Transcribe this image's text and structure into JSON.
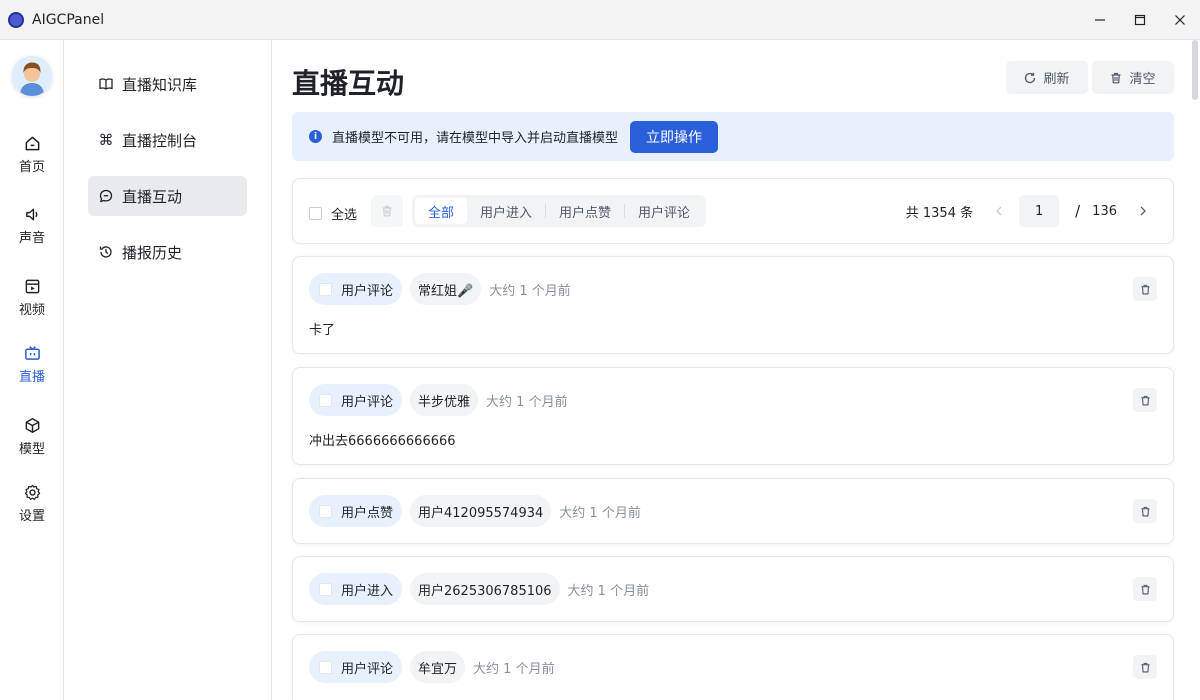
{
  "window": {
    "title": "AIGCPanel"
  },
  "leftnav": [
    {
      "label": "首页",
      "icon": "home-icon"
    },
    {
      "label": "声音",
      "icon": "speaker-icon"
    },
    {
      "label": "视频",
      "icon": "film-icon"
    },
    {
      "label": "直播",
      "icon": "tv-icon",
      "active": true
    },
    {
      "label": "模型",
      "icon": "cube-icon"
    },
    {
      "label": "设置",
      "icon": "gear-icon"
    }
  ],
  "subnav": [
    {
      "label": "直播知识库",
      "icon": "book-icon"
    },
    {
      "label": "直播控制台",
      "icon": "command-icon"
    },
    {
      "label": "直播互动",
      "icon": "chat-icon",
      "active": true
    },
    {
      "label": "播报历史",
      "icon": "history-icon"
    }
  ],
  "main": {
    "title": "直播互动",
    "refresh_label": "刷新",
    "clear_label": "清空",
    "alert": {
      "text": "直播模型不可用，请在模型中导入并启动直播模型",
      "button": "立即操作"
    },
    "toolbar": {
      "select_all": "全选",
      "filters": [
        "全部",
        "用户进入",
        "用户点赞",
        "用户评论"
      ],
      "active_filter": "全部",
      "total": "共 1354 条",
      "current_page": "1",
      "slash": "/",
      "total_pages": "136"
    },
    "items": [
      {
        "type": "用户评论",
        "user": "常红姐🎤",
        "time": "大约 1 个月前",
        "content": "卡了"
      },
      {
        "type": "用户评论",
        "user": "半步优雅",
        "time": "大约 1 个月前",
        "content": "冲出去6666666666666"
      },
      {
        "type": "用户点赞",
        "user": "用户412095574934",
        "time": "大约 1 个月前",
        "content": ""
      },
      {
        "type": "用户进入",
        "user": "用户2625306785106",
        "time": "大约 1 个月前",
        "content": ""
      },
      {
        "type": "用户评论",
        "user": "牟宜万",
        "time": "大约 1 个月前",
        "content": ""
      }
    ]
  },
  "colors": {
    "accent": "#2b5fd9",
    "alert_bg": "#e8f0fd",
    "tag_bg": "#e8f0fd"
  }
}
